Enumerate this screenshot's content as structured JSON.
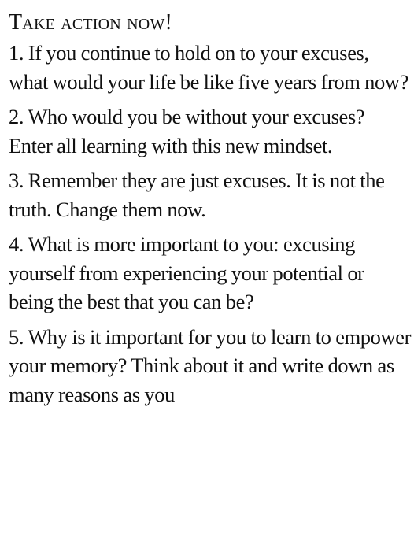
{
  "heading": "Take action now!",
  "items": [
    {
      "text": "1. If you continue to hold on to your excuses, what would your life be like five years from now?"
    },
    {
      "text": "2. Who would you be without your excuses? Enter all learning with this new mindset."
    },
    {
      "text": "3. Remember they are just excuses. It is not the truth. Change them now."
    },
    {
      "text": "4. What is more important to you: excusing yourself from experiencing your potential or being the best that you can be?"
    },
    {
      "text": "5. Why is it important for you to learn to empower your memory? Think about it and write down as many reasons as you"
    }
  ]
}
